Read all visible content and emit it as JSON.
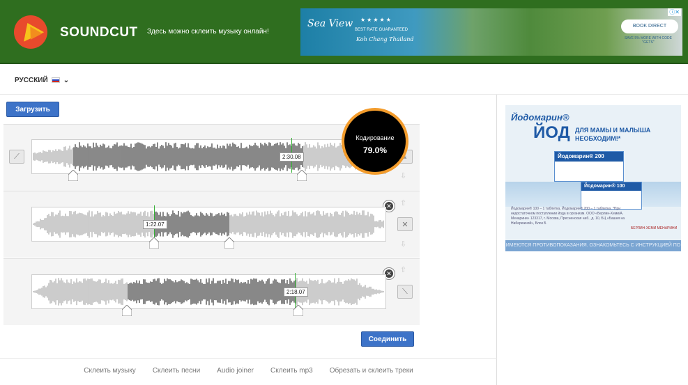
{
  "header": {
    "brand": "SOUNDCUT",
    "tagline": "Здесь можно склеить музыку онлайн!",
    "ad": {
      "name": "Sea View",
      "stars": "★★★★★",
      "best_rate": "BEST RATE GUARANTEED",
      "location": "Koh Chang Thailand",
      "cta": "BOOK DIRECT",
      "save": "SAVE 5% MORE WITH CODE \"GETS\"",
      "ad_marker": "ⓘ✕"
    }
  },
  "language": {
    "label": "РУССКИЙ"
  },
  "toolbar": {
    "upload_label": "Загрузить",
    "join_label": "Соединить"
  },
  "encoding": {
    "label": "Кодирование",
    "percent": "79.0%",
    "progress": 0.79
  },
  "tracks": [
    {
      "time_label": "2:30.08",
      "fade_icon": "fade-in-icon"
    },
    {
      "time_label": "1:22.07",
      "fade_icon": "crossfade-icon"
    },
    {
      "time_label": "2:18.07",
      "fade_icon": "fade-out-icon"
    }
  ],
  "footer": {
    "links": [
      "Склеить музыку",
      "Склеить песни",
      "Audio joiner",
      "Склеить mp3",
      "Обрезать и склеить треки"
    ]
  },
  "ad_right": {
    "brand": "Йодомарин®",
    "headline": "ЙОД",
    "slogan": "ДЛЯ МАМЫ И МАЛЫША НЕОБХОДИМ!*",
    "box1": "Йодомарин® 200",
    "box2": "Йодомарин® 100",
    "fine_print": "Йодомарин® 100 – 1 таблетка, Йодомарин® 200 – 1 таблетка. *При недостаточном поступлении йода в организм. ООО «Берлин-Хеми/А. Менарини» 123317, г. Москва, Пресненская наб., д. 10, БЦ «Башня на Набережной», Блок Б",
    "company": "БЕРЛИН-ХЕМИ МЕНАРИНИ",
    "warning": "ИМЕЮТСЯ ПРОТИВОПОКАЗАНИЯ. ОЗНАКОМЬТЕСЬ С ИНСТРУКЦИЕЙ ПО ПРИМЕНЕНИЮ"
  }
}
